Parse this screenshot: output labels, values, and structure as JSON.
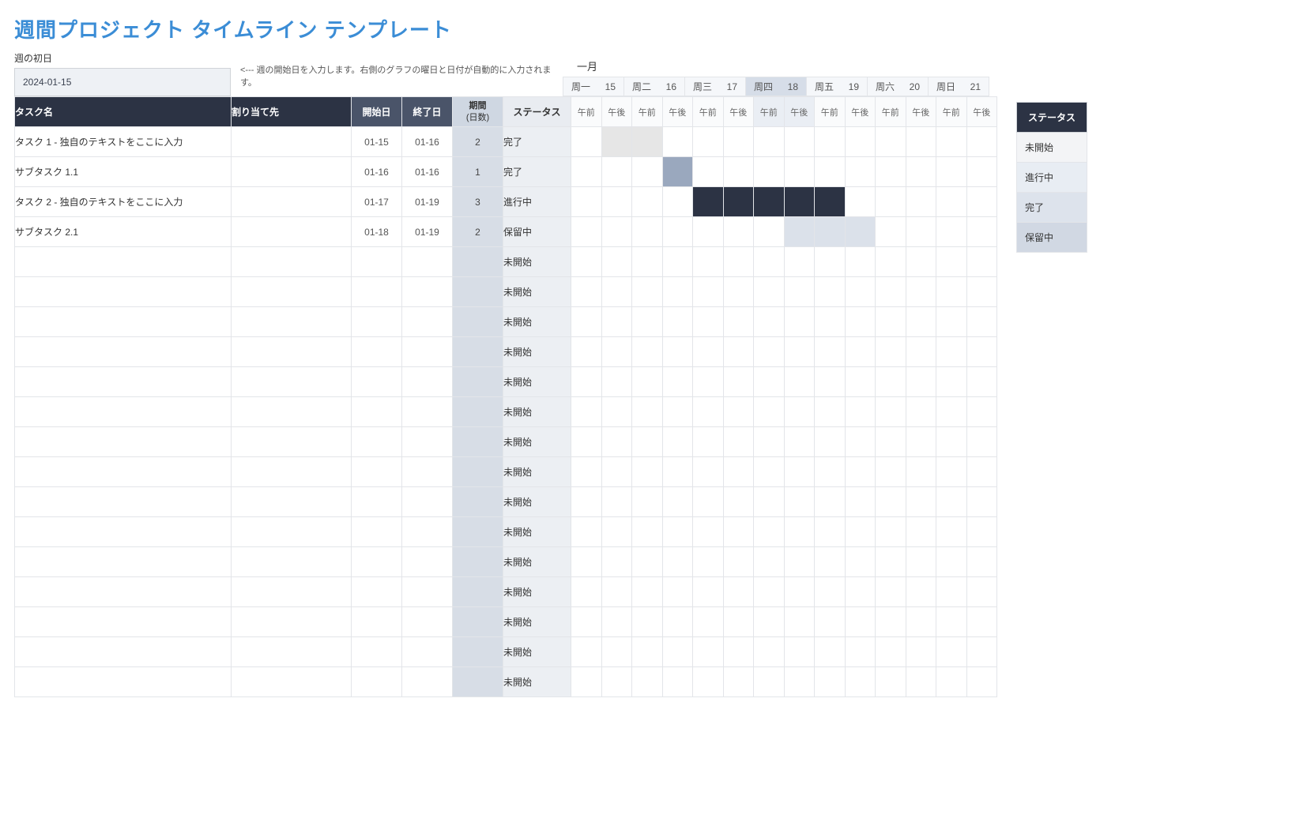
{
  "title": "週間プロジェクト タイムライン テンプレート",
  "week_start_label": "週の初日",
  "week_start_value": "2024-01-15",
  "instruction": "<--- 週の開始日を入力します。右側のグラフの曜日と日付が自動的に入力されます。",
  "month_label": "一月",
  "headers": {
    "task": "タスク名",
    "assignee": "割り当て先",
    "start": "開始日",
    "end": "終了日",
    "duration": "期間",
    "duration_sub": "(日数)",
    "status": "ステータス"
  },
  "days": [
    {
      "dow": "周一",
      "num": "15",
      "thu": false
    },
    {
      "dow": "周二",
      "num": "16",
      "thu": false
    },
    {
      "dow": "周三",
      "num": "17",
      "thu": false
    },
    {
      "dow": "周四",
      "num": "18",
      "thu": true
    },
    {
      "dow": "周五",
      "num": "19",
      "thu": false
    },
    {
      "dow": "周六",
      "num": "20",
      "thu": false
    },
    {
      "dow": "周日",
      "num": "21",
      "thu": false
    }
  ],
  "ampm": {
    "am": "午前",
    "pm": "午後"
  },
  "rows": [
    {
      "task": "タスク 1 - 独自のテキストをここに入力",
      "assignee": "",
      "start": "01-15",
      "end": "01-16",
      "duration": "2",
      "status": "完了",
      "bars": [
        "",
        "fill-light",
        "fill-light",
        "",
        "",
        "",
        "",
        "",
        "",
        "",
        "",
        "",
        "",
        ""
      ]
    },
    {
      "task": "サブタスク 1.1",
      "assignee": "",
      "start": "01-16",
      "end": "01-16",
      "duration": "1",
      "status": "完了",
      "bars": [
        "",
        "",
        "",
        "fill-steel",
        "",
        "",
        "",
        "",
        "",
        "",
        "",
        "",
        "",
        ""
      ]
    },
    {
      "task": "タスク 2 - 独自のテキストをここに入力",
      "assignee": "",
      "start": "01-17",
      "end": "01-19",
      "duration": "3",
      "status": "進行中",
      "bars": [
        "",
        "",
        "",
        "",
        "fill-dark",
        "fill-dark",
        "fill-dark",
        "fill-dark",
        "fill-dark",
        "",
        "",
        "",
        "",
        ""
      ]
    },
    {
      "task": "サブタスク 2.1",
      "assignee": "",
      "start": "01-18",
      "end": "01-19",
      "duration": "2",
      "status": "保留中",
      "bars": [
        "",
        "",
        "",
        "",
        "",
        "",
        "",
        "fill-pale",
        "fill-pale",
        "fill-pale",
        "",
        "",
        "",
        ""
      ]
    },
    {
      "task": "",
      "assignee": "",
      "start": "",
      "end": "",
      "duration": "",
      "status": "未開始",
      "bars": [
        "",
        "",
        "",
        "",
        "",
        "",
        "",
        "",
        "",
        "",
        "",
        "",
        "",
        ""
      ]
    },
    {
      "task": "",
      "assignee": "",
      "start": "",
      "end": "",
      "duration": "",
      "status": "未開始",
      "bars": [
        "",
        "",
        "",
        "",
        "",
        "",
        "",
        "",
        "",
        "",
        "",
        "",
        "",
        ""
      ]
    },
    {
      "task": "",
      "assignee": "",
      "start": "",
      "end": "",
      "duration": "",
      "status": "未開始",
      "bars": [
        "",
        "",
        "",
        "",
        "",
        "",
        "",
        "",
        "",
        "",
        "",
        "",
        "",
        ""
      ]
    },
    {
      "task": "",
      "assignee": "",
      "start": "",
      "end": "",
      "duration": "",
      "status": "未開始",
      "bars": [
        "",
        "",
        "",
        "",
        "",
        "",
        "",
        "",
        "",
        "",
        "",
        "",
        "",
        ""
      ]
    },
    {
      "task": "",
      "assignee": "",
      "start": "",
      "end": "",
      "duration": "",
      "status": "未開始",
      "bars": [
        "",
        "",
        "",
        "",
        "",
        "",
        "",
        "",
        "",
        "",
        "",
        "",
        "",
        ""
      ]
    },
    {
      "task": "",
      "assignee": "",
      "start": "",
      "end": "",
      "duration": "",
      "status": "未開始",
      "bars": [
        "",
        "",
        "",
        "",
        "",
        "",
        "",
        "",
        "",
        "",
        "",
        "",
        "",
        ""
      ]
    },
    {
      "task": "",
      "assignee": "",
      "start": "",
      "end": "",
      "duration": "",
      "status": "未開始",
      "bars": [
        "",
        "",
        "",
        "",
        "",
        "",
        "",
        "",
        "",
        "",
        "",
        "",
        "",
        ""
      ]
    },
    {
      "task": "",
      "assignee": "",
      "start": "",
      "end": "",
      "duration": "",
      "status": "未開始",
      "bars": [
        "",
        "",
        "",
        "",
        "",
        "",
        "",
        "",
        "",
        "",
        "",
        "",
        "",
        ""
      ]
    },
    {
      "task": "",
      "assignee": "",
      "start": "",
      "end": "",
      "duration": "",
      "status": "未開始",
      "bars": [
        "",
        "",
        "",
        "",
        "",
        "",
        "",
        "",
        "",
        "",
        "",
        "",
        "",
        ""
      ]
    },
    {
      "task": "",
      "assignee": "",
      "start": "",
      "end": "",
      "duration": "",
      "status": "未開始",
      "bars": [
        "",
        "",
        "",
        "",
        "",
        "",
        "",
        "",
        "",
        "",
        "",
        "",
        "",
        ""
      ]
    },
    {
      "task": "",
      "assignee": "",
      "start": "",
      "end": "",
      "duration": "",
      "status": "未開始",
      "bars": [
        "",
        "",
        "",
        "",
        "",
        "",
        "",
        "",
        "",
        "",
        "",
        "",
        "",
        ""
      ]
    },
    {
      "task": "",
      "assignee": "",
      "start": "",
      "end": "",
      "duration": "",
      "status": "未開始",
      "bars": [
        "",
        "",
        "",
        "",
        "",
        "",
        "",
        "",
        "",
        "",
        "",
        "",
        "",
        ""
      ]
    },
    {
      "task": "",
      "assignee": "",
      "start": "",
      "end": "",
      "duration": "",
      "status": "未開始",
      "bars": [
        "",
        "",
        "",
        "",
        "",
        "",
        "",
        "",
        "",
        "",
        "",
        "",
        "",
        ""
      ]
    },
    {
      "task": "",
      "assignee": "",
      "start": "",
      "end": "",
      "duration": "",
      "status": "未開始",
      "bars": [
        "",
        "",
        "",
        "",
        "",
        "",
        "",
        "",
        "",
        "",
        "",
        "",
        "",
        ""
      ]
    },
    {
      "task": "",
      "assignee": "",
      "start": "",
      "end": "",
      "duration": "",
      "status": "未開始",
      "bars": [
        "",
        "",
        "",
        "",
        "",
        "",
        "",
        "",
        "",
        "",
        "",
        "",
        "",
        ""
      ]
    }
  ],
  "legend": {
    "header": "ステータス",
    "items": [
      "未開始",
      "進行中",
      "完了",
      "保留中"
    ]
  }
}
